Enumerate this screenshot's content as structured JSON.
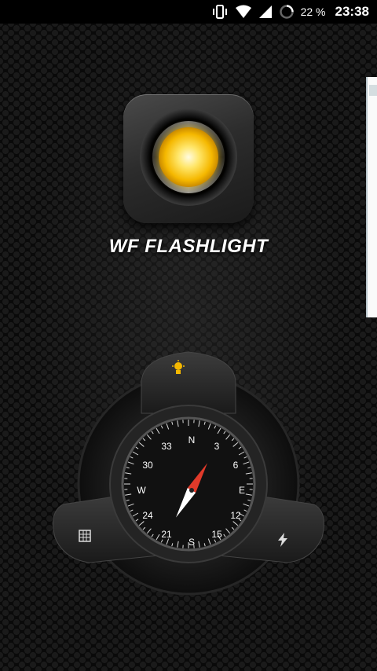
{
  "status_bar": {
    "battery_percent": "22 %",
    "time": "23:38",
    "icons": [
      "vibrate-icon",
      "wifi-icon",
      "signal-icon",
      "battery-icon"
    ]
  },
  "app": {
    "title": "WF FLASHLIGHT",
    "icon": "flashlight-lens-icon",
    "accent": "#f5b800"
  },
  "dock": {
    "buttons": [
      {
        "name": "flashlight-toggle",
        "icon": "lightbulb-icon"
      },
      {
        "name": "screen-light",
        "icon": "screen-grid-icon"
      },
      {
        "name": "strobe",
        "icon": "lightning-icon"
      }
    ],
    "compass": {
      "heading_deg": 30,
      "cardinals": {
        "n": "N",
        "e": "E",
        "s": "S",
        "w": "W"
      },
      "numbers": [
        "3",
        "6",
        "12",
        "15",
        "21",
        "24",
        "30",
        "33"
      ]
    }
  }
}
